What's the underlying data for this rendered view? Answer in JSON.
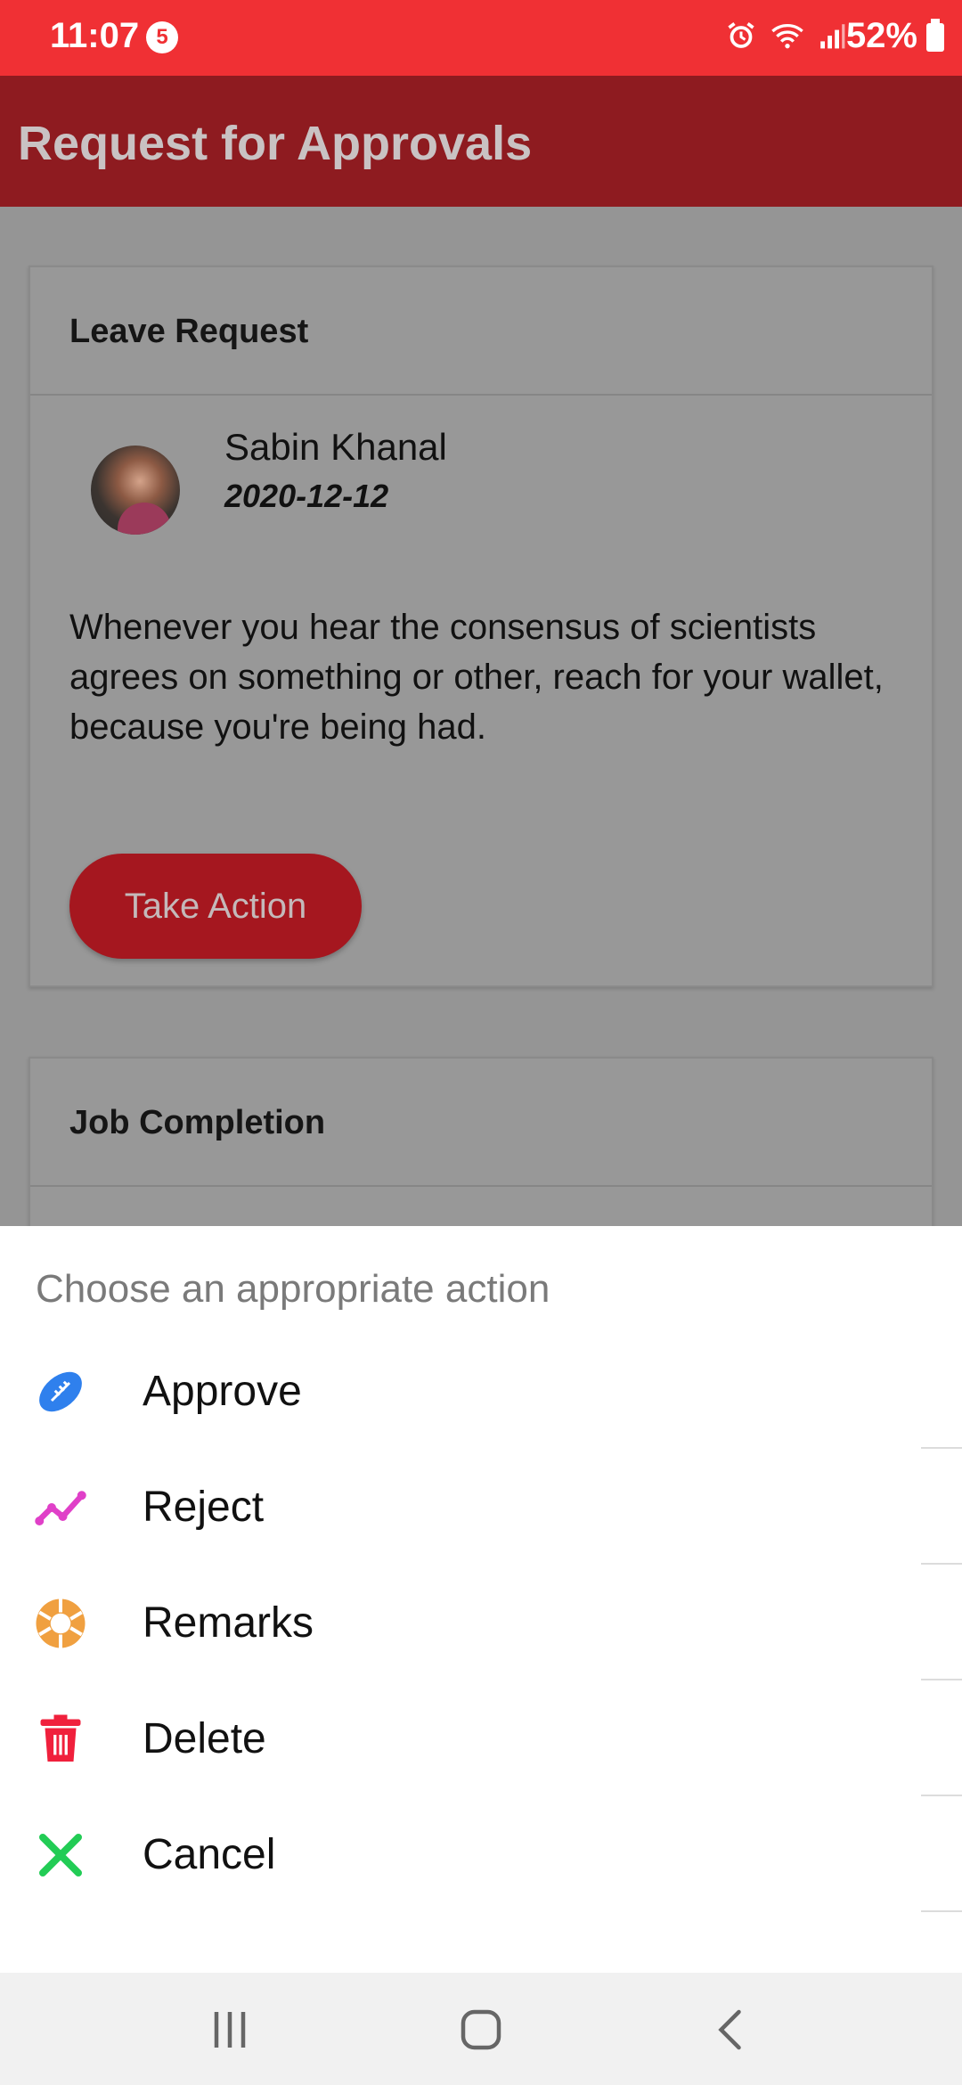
{
  "status_bar": {
    "time": "11:07",
    "notification_count": "5",
    "battery": "52%",
    "icons": [
      "alarm-icon",
      "wifi-icon",
      "signal-icon",
      "battery-icon"
    ]
  },
  "app_bar": {
    "title": "Request for Approvals"
  },
  "cards": [
    {
      "header": "Leave Request",
      "name": "Sabin Khanal",
      "date": "2020-12-12",
      "message": "Whenever you hear the consensus of scientists agrees on something or other, reach for your wallet, because you're being had.",
      "action_label": "Take Action"
    },
    {
      "header": "Job Completion"
    }
  ],
  "sheet": {
    "title": "Choose an appropriate action",
    "items": [
      {
        "label": "Approve",
        "icon": "football-icon",
        "color": "#2f80ed"
      },
      {
        "label": "Reject",
        "icon": "line-chart-icon",
        "color": "#e040c8"
      },
      {
        "label": "Remarks",
        "icon": "aperture-icon",
        "color": "#f0a040"
      },
      {
        "label": "Delete",
        "icon": "trash-icon",
        "color": "#f0203c"
      },
      {
        "label": "Cancel",
        "icon": "close-icon",
        "color": "#22cc55"
      }
    ]
  },
  "nav_bar": {
    "icons": [
      "recents-icon",
      "home-icon",
      "back-icon"
    ]
  }
}
